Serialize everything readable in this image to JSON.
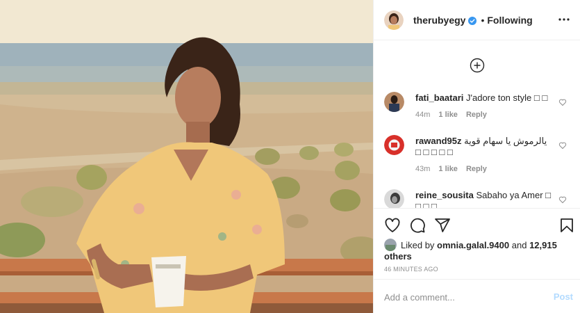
{
  "post": {
    "username": "therubyegy",
    "separator": "•",
    "follow_status": "Following"
  },
  "comments": [
    {
      "username": "fati_baatari",
      "text": "J'adore ton style □ □",
      "time": "44m",
      "likes": "1 like",
      "reply": "Reply"
    },
    {
      "username": "rawand95z",
      "text": "يالرموش يا سهام قوية □ □ □ □ □",
      "time": "43m",
      "likes": "1 like",
      "reply": "Reply"
    },
    {
      "username": "reine_sousita",
      "text": "Sabaho ya Amer □ □ □ □",
      "time": "",
      "likes": "",
      "reply": ""
    }
  ],
  "likes": {
    "prefix": "Liked by",
    "user": "omnia.galal.9400",
    "and": "and",
    "others": "12,915 others"
  },
  "timestamp": "46 MINUTES AGO",
  "add_comment": {
    "placeholder": "Add a comment...",
    "post_label": "Post"
  },
  "icons": {
    "more": "more-icon",
    "add": "add-circle-icon",
    "like": "heart-icon",
    "comment": "comment-icon",
    "share": "share-icon",
    "save": "bookmark-icon",
    "verified": "verified-badge-icon"
  },
  "colors": {
    "text": "#262626",
    "muted": "#8e8e8e",
    "verified": "#3897f0",
    "post_disabled": "#b3dbff",
    "divider": "#efefef"
  }
}
